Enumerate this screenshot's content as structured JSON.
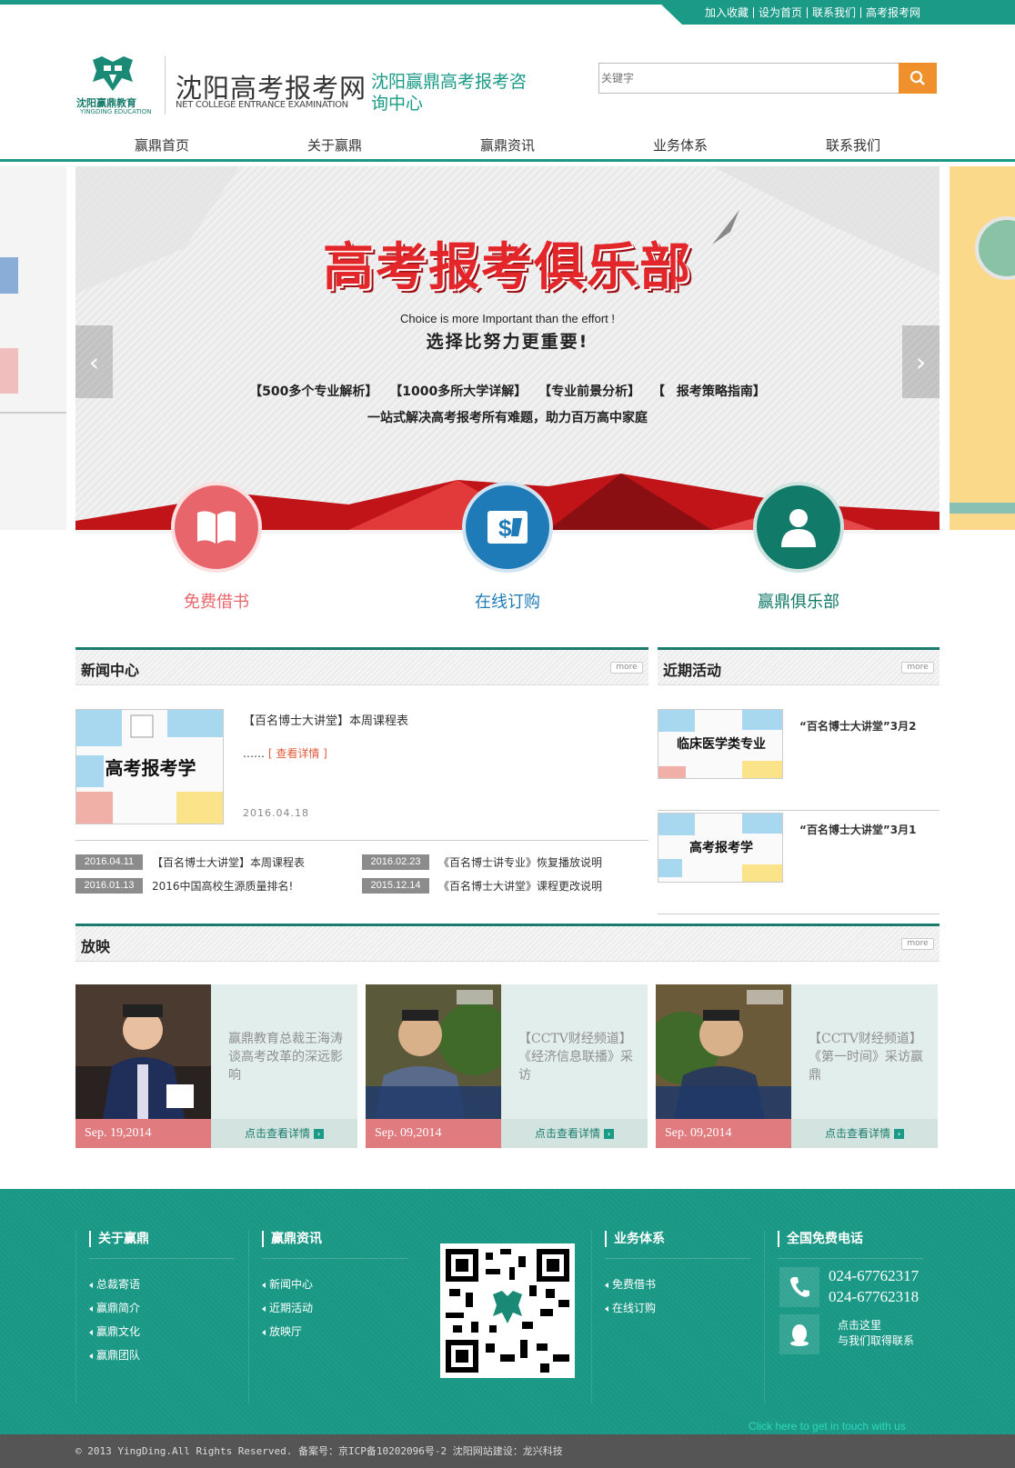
{
  "toplinks": [
    "加入收藏",
    "设为首页",
    "联系我们",
    "高考报考网"
  ],
  "logo": {
    "cn": "沈阳赢鼎教育",
    "en": "YINGDING EDUCATION"
  },
  "site": {
    "title": "沈阳高考报考网",
    "subtitle": "NET COLLEGE ENTRANCE EXAMINATION",
    "slogan": "沈阳赢鼎高考报考咨询中心"
  },
  "search": {
    "placeholder": "关键字"
  },
  "nav": [
    "赢鼎首页",
    "关于赢鼎",
    "赢鼎资讯",
    "业务体系",
    "联系我们"
  ],
  "banner": {
    "title": "高考报考俱乐部",
    "en": "Choice is more Important than the effort !",
    "cn": "选择比努力更重要!",
    "tags": "【500多个专业解析】 【1000多所大学详解】 【专业前景分析】 【 报考策略指南】",
    "line": "一站式解决高考报考所有难题，助力百万高中家庭"
  },
  "features": [
    {
      "label": "免费借书",
      "color": "#e8666b"
    },
    {
      "label": "在线订购",
      "color": "#1f7bb7"
    },
    {
      "label": "赢鼎俱乐部",
      "color": "#127a68"
    }
  ],
  "news": {
    "title": "新闻中心",
    "more": "more",
    "feature": {
      "img_text": "高考报考学",
      "title": "【百名博士大讲堂】本周课程表",
      "dots": "……",
      "more": "[ 查看详情 ]",
      "date": "2016.04.18"
    },
    "items": [
      {
        "date": "2016.04.11",
        "title": "【百名博士大讲堂】本周课程表"
      },
      {
        "date": "2016.02.23",
        "title": "《百名博士讲专业》恢复播放说明"
      },
      {
        "date": "2016.01.13",
        "title": "2016中国高校生源质量排名!"
      },
      {
        "date": "2015.12.14",
        "title": "《百名博士大讲堂》课程更改说明"
      }
    ]
  },
  "recent": {
    "title": "近期活动",
    "more": "more",
    "items": [
      {
        "img_text": "临床医学类专业",
        "title": "“百名博士大讲堂”3月2"
      },
      {
        "img_text": "高考报考学",
        "title": "“百名博士大讲堂”3月1"
      }
    ]
  },
  "video": {
    "title": "放映",
    "more": "more",
    "cards": [
      {
        "desc": "赢鼎教育总裁王海涛谈高考改革的深远影响",
        "date": "Sep. 19,2014",
        "link": "点击查看详情"
      },
      {
        "desc": "【CCTV财经频道】《经济信息联播》采访",
        "date": "Sep. 09,2014",
        "link": "点击查看详情"
      },
      {
        "desc": "【CCTV财经频道】《第一时间》采访赢鼎",
        "date": "Sep. 09,2014",
        "link": "点击查看详情"
      }
    ]
  },
  "footer": {
    "cols": [
      {
        "title": "关于赢鼎",
        "links": [
          "总裁寄语",
          "赢鼎简介",
          "赢鼎文化",
          "赢鼎团队"
        ]
      },
      {
        "title": "赢鼎资讯",
        "links": [
          "新闻中心",
          "近期活动",
          "放映厅"
        ]
      },
      {
        "title": "业务体系",
        "links": [
          "免费借书",
          "在线订购"
        ]
      }
    ],
    "hotline_title": "全国免费电话",
    "phones": [
      "024-67762317",
      "024-67762318"
    ],
    "contact_line1": "点击这里",
    "contact_line2": "与我们取得联系",
    "contact_en": "Click here to get in touch with us",
    "copyright": "© 2013 YingDing.All Rights Reserved. 备案号：京ICP备10202096号-2 沈阳网站建设：龙兴科技"
  }
}
